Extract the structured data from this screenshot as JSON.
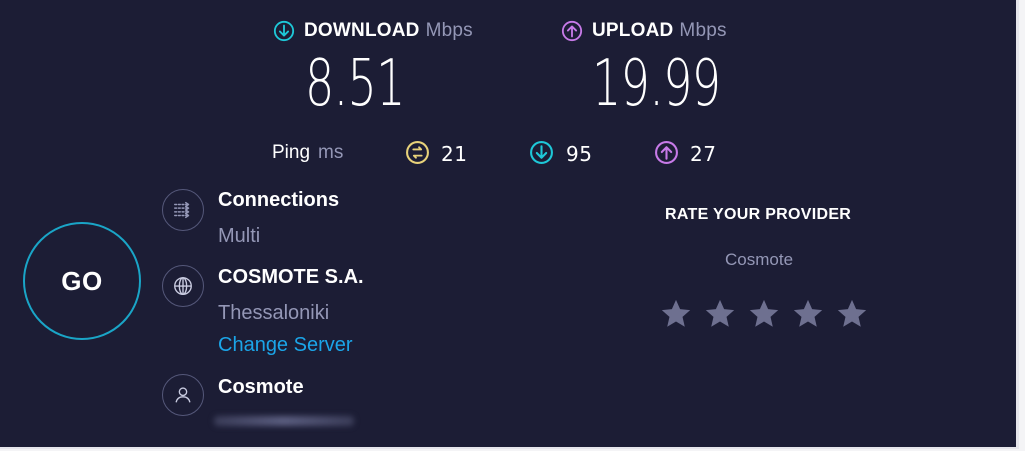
{
  "download": {
    "label": "DOWNLOAD",
    "unit": "Mbps",
    "value": "8.51",
    "icon": "download-arrow-icon",
    "color": "#1ec8d8"
  },
  "upload": {
    "label": "UPLOAD",
    "unit": "Mbps",
    "value": "19.99",
    "icon": "upload-arrow-icon",
    "color": "#c77ae8"
  },
  "ping": {
    "label": "Ping",
    "unit": "ms",
    "idle": "21",
    "download": "95",
    "upload": "27",
    "idle_color": "#e8d27a"
  },
  "go_button": {
    "label": "GO",
    "ring_color": "#1aa5c7"
  },
  "connections": {
    "title": "Connections",
    "value": "Multi",
    "icon": "connections-icon"
  },
  "server": {
    "isp": "COSMOTE S.A.",
    "location": "Thessaloniki",
    "change_label": "Change Server",
    "icon": "globe-icon"
  },
  "user": {
    "name": "Cosmote",
    "icon": "user-icon"
  },
  "rating": {
    "title": "RATE YOUR PROVIDER",
    "provider": "Cosmote",
    "stars_total": 5,
    "star_color": "#6e7090"
  }
}
